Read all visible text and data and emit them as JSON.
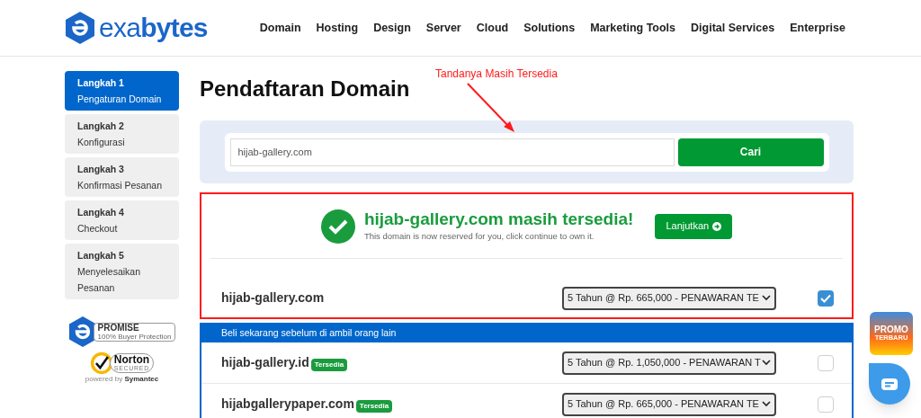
{
  "logo": {
    "text_light": "exa",
    "text_bold": "bytes"
  },
  "nav": [
    {
      "label": "Domain"
    },
    {
      "label": "Hosting"
    },
    {
      "label": "Design"
    },
    {
      "label": "Server"
    },
    {
      "label": "Cloud"
    },
    {
      "label": "Solutions"
    },
    {
      "label": "Marketing Tools"
    },
    {
      "label": "Digital Services"
    },
    {
      "label": "Enterprise"
    }
  ],
  "steps": [
    {
      "title": "Langkah 1",
      "label": "Pengaturan Domain",
      "selected": true
    },
    {
      "title": "Langkah 2",
      "label": "Konfigurasi",
      "selected": false
    },
    {
      "title": "Langkah 3",
      "label": "Konfirmasi Pesanan",
      "selected": false
    },
    {
      "title": "Langkah 4",
      "label": "Checkout",
      "selected": false
    },
    {
      "title": "Langkah 5",
      "label": "Menyelesaikan Pesanan",
      "selected": false
    }
  ],
  "trust_badges": {
    "promise_title": "PROMISE",
    "promise_sub": "100% Buyer Protection",
    "norton_title": "Norton",
    "norton_sub": "SECURED",
    "powered": "powered by",
    "powered_brand": "Symantec"
  },
  "page_title": "Pendaftaran Domain",
  "search": {
    "value": "hijab-gallery.com",
    "button": "Cari"
  },
  "annotation": {
    "text": "Tandanya Masih Tersedia"
  },
  "result": {
    "headline": "hijab-gallery.com masih tersedia!",
    "subtext": "This domain is now reserved for you, click continue to own it.",
    "button": "Lanjutkan"
  },
  "main_domain": {
    "name": "hijab-gallery.com",
    "option": "5 Tahun @ Rp. 665,000 - PENAWARAN TE",
    "checked": true
  },
  "suggestions_header": "Beli sekarang sebelum di ambil orang lain",
  "suggestions": [
    {
      "name": "hijab-gallery.id",
      "badge": "Tersedia",
      "option": "5 Tahun @ Rp. 1,050,000 - PENAWARAN T",
      "checked": false
    },
    {
      "name": "hijabgallerypaper.com",
      "badge": "Tersedia",
      "option": "5 Tahun @ Rp. 665,000 - PENAWARAN TE",
      "checked": false
    }
  ],
  "promo": {
    "line1": "PROMO",
    "line2": "TERBARU"
  }
}
